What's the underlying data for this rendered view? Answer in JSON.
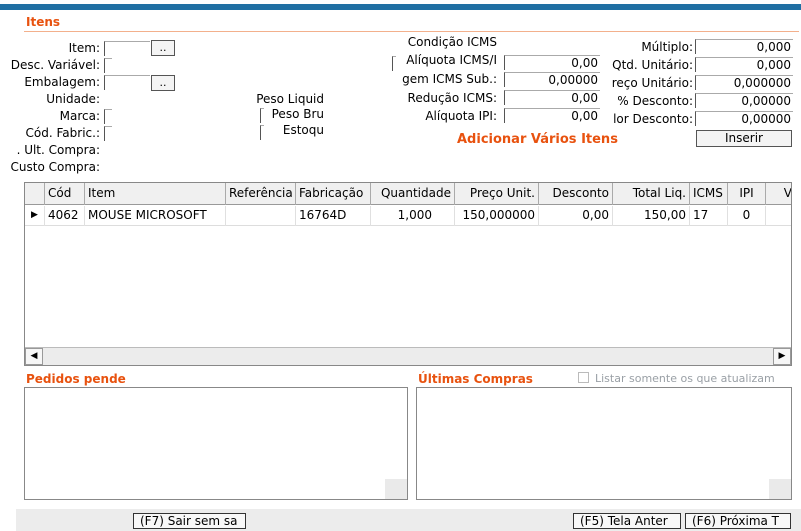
{
  "section": {
    "title": "Itens"
  },
  "left_form": {
    "item_label": "Item:",
    "item_button": "..",
    "desc_variavel_label": "Desc. Variável:",
    "embalagem_label": "Embalagem:",
    "embalagem_button": "..",
    "unidade_label": "Unidade:",
    "marca_label": "Marca:",
    "cod_fabric_label": "Cód. Fabric.:",
    "ult_compra_label": ". Ult. Compra:",
    "custo_compra_label": "Custo Compra:"
  },
  "weights": {
    "peso_liquid_label": "Peso Liquid",
    "peso_bru_label": "Peso Bru",
    "estoque_label": "Estoqu"
  },
  "mid_form": {
    "condicao_icms_label": "Condição ICMS",
    "aliquota_icms_label": "Alíquota ICMS/I",
    "aliquota_icms_value": "0,00",
    "margem_icms_sub_label": "gem ICMS Sub.:",
    "margem_icms_sub_value": "0,00000",
    "reducao_icms_label": "Redução ICMS:",
    "reducao_icms_value": "0,00",
    "aliquota_ipi_label": "Alíquota IPI:",
    "aliquota_ipi_value": "0,00"
  },
  "right_form": {
    "multiplo_label": "Múltiplo:",
    "multiplo_value": "0,000",
    "qtd_unitario_label": "Qtd. Unitário:",
    "qtd_unitario_value": "0,000",
    "preco_unitario_label": "reço Unitário:",
    "preco_unitario_value": "0,000000",
    "perc_desconto_label": "% Desconto:",
    "perc_desconto_value": "0,00000",
    "valor_desconto_label": "lor Desconto:",
    "valor_desconto_value": "0,00000",
    "inserir_button": "Inserir"
  },
  "add_multiple_link": "Adicionar Vários Itens",
  "grid": {
    "columns": [
      "Cód",
      "Item",
      "Referência",
      "Fabricação",
      "Quantidade",
      "Preço Unit.",
      "Desconto",
      "Total Liq.",
      "ICMS",
      "IPI",
      "V"
    ],
    "rows": [
      {
        "cod": "4062",
        "item": "MOUSE MICROSOFT",
        "referencia": "",
        "fabricacao": "16764D",
        "quantidade": "1,000",
        "preco_unit": "150,000000",
        "desconto": "0,00",
        "total_liq": "150,00",
        "icms": "17",
        "ipi": "0",
        "v": ""
      }
    ]
  },
  "pending_orders": {
    "title": "Pedidos pende"
  },
  "last_purchases": {
    "title": "Últimas Compras",
    "checkbox_label": "Listar somente os que atualizam"
  },
  "footer": {
    "exit_button": "(F7) Sair sem sa",
    "prev_button": "(F5) Tela Anter",
    "next_button": "(F6) Próxima T"
  },
  "colors": {
    "accent": "#e8520f",
    "topbar": "#1f6fa3"
  }
}
